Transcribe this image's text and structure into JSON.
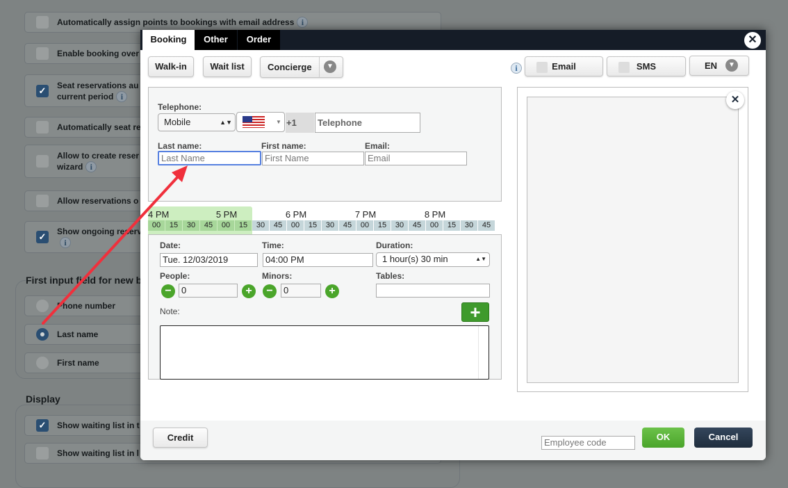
{
  "background": {
    "items": [
      {
        "label": "Automatically assign points to bookings with email address",
        "checked": false,
        "info": true
      },
      {
        "label": "Enable booking over",
        "checked": false
      },
      {
        "label": "Seat reservations au",
        "label2": "current period",
        "checked": true,
        "info": true
      },
      {
        "label": "Automatically seat re",
        "checked": false
      },
      {
        "label": "Allow to create reser",
        "label2": "wizard",
        "checked": false,
        "info": true
      },
      {
        "label": "Allow reservations o",
        "checked": false
      },
      {
        "label": "Show ongoing reserv",
        "checked": true,
        "info": true
      }
    ],
    "first_input_group": {
      "title": "First input field for new b",
      "options": [
        {
          "label": "Phone number",
          "selected": false
        },
        {
          "label": "Last name",
          "selected": true
        },
        {
          "label": "First name",
          "selected": false
        }
      ]
    },
    "display_group": {
      "title": "Display",
      "items": [
        {
          "label": "Show waiting list in t",
          "checked": true
        },
        {
          "label": "Show waiting list in l",
          "checked": false
        }
      ]
    }
  },
  "modal": {
    "tabs": [
      {
        "label": "Booking",
        "active": true
      },
      {
        "label": "Other"
      },
      {
        "label": "Order"
      }
    ],
    "toolbar": {
      "walkin": "Walk-in",
      "waitlist": "Wait list",
      "concierge": "Concierge",
      "email": "Email",
      "sms": "SMS",
      "lang": "EN"
    },
    "contact": {
      "telephone_label": "Telephone:",
      "phone_type": "Mobile",
      "country_code": "+1",
      "telephone_placeholder": "Telephone",
      "last_name_label": "Last name:",
      "last_name_placeholder": "Last Name",
      "first_name_label": "First name:",
      "first_name_placeholder": "First Name",
      "email_label": "Email:",
      "email_placeholder": "Email"
    },
    "timeline": {
      "hours": [
        "4 PM",
        "5 PM",
        "6 PM",
        "7 PM",
        "8 PM"
      ],
      "ticks": [
        "00",
        "15",
        "30",
        "45",
        "00",
        "15",
        "30",
        "45",
        "00",
        "15",
        "30",
        "45",
        "00",
        "15",
        "30",
        "45",
        "00",
        "15",
        "30",
        "45"
      ],
      "selected_ticks": 6
    },
    "details": {
      "date_label": "Date:",
      "date": "Tue. 12/03/2019",
      "time_label": "Time:",
      "time": "04:00 PM",
      "duration_label": "Duration:",
      "duration": "1 hour(s) 30 min",
      "people_label": "People:",
      "people": "0",
      "minors_label": "Minors:",
      "minors": "0",
      "tables_label": "Tables:",
      "tables": "",
      "note_label": "Note:"
    },
    "footer": {
      "credit": "Credit",
      "employee_placeholder": "Employee code",
      "ok": "OK",
      "cancel": "Cancel"
    }
  },
  "colors": {
    "header": "#151c27",
    "ok": "#4aa52a",
    "cancel": "#1f2d3d",
    "annotation_arrow": "#f0303c",
    "timeline_selected": "#a7d79a"
  }
}
